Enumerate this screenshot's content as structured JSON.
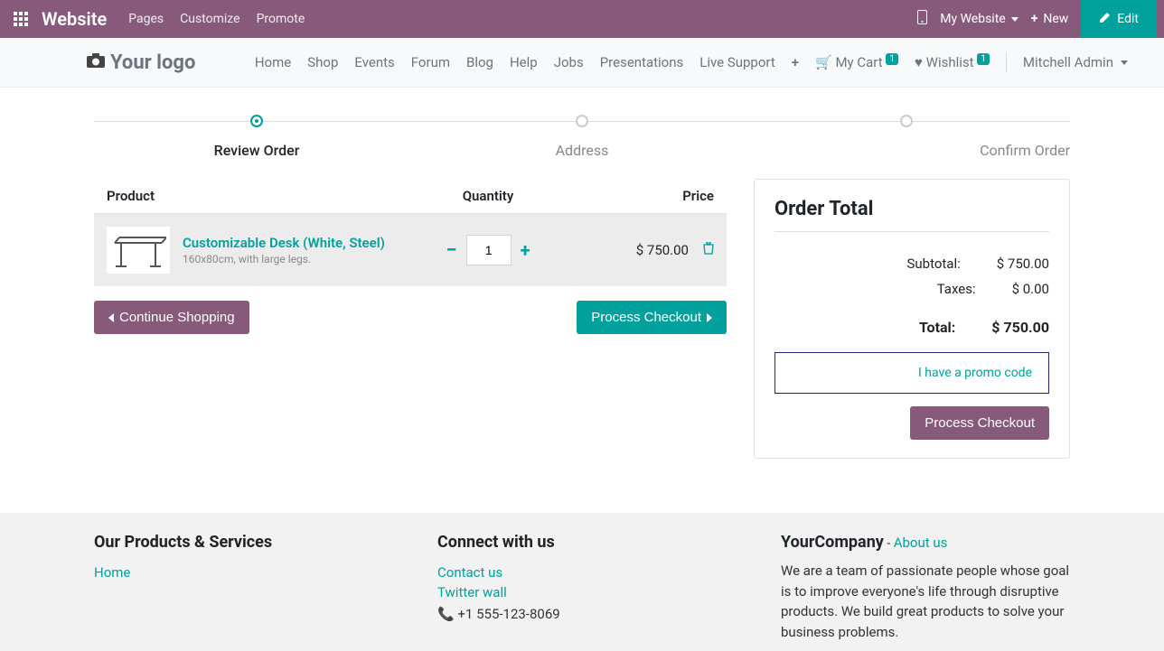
{
  "topbar": {
    "brand": "Website",
    "menu": [
      "Pages",
      "Customize",
      "Promote"
    ],
    "mywebsite": "My Website",
    "new": "New",
    "edit": "Edit"
  },
  "nav": {
    "logo": "Your logo",
    "items": [
      "Home",
      "Shop",
      "Events",
      "Forum",
      "Blog",
      "Help",
      "Jobs",
      "Presentations",
      "Live Support"
    ],
    "cart_label": "My Cart",
    "cart_count": "1",
    "wishlist_label": "Wishlist",
    "wishlist_count": "1",
    "user": "Mitchell Admin"
  },
  "wizard": {
    "steps": [
      "Review Order",
      "Address",
      "Confirm Order"
    ],
    "active": 0
  },
  "cart": {
    "headers": {
      "product": "Product",
      "quantity": "Quantity",
      "price": "Price"
    },
    "item": {
      "name": "Customizable Desk (White, Steel)",
      "desc": "160x80cm, with large legs.",
      "qty": "1",
      "price": "$ 750.00"
    },
    "continue": "Continue Shopping",
    "process": "Process Checkout"
  },
  "order": {
    "title": "Order Total",
    "subtotal_label": "Subtotal:",
    "subtotal": "$ 750.00",
    "taxes_label": "Taxes:",
    "taxes": "$ 0.00",
    "total_label": "Total:",
    "total": "$ 750.00",
    "promo": "I have a promo code",
    "process": "Process Checkout"
  },
  "footer": {
    "col1": {
      "title": "Our Products & Services",
      "links": [
        "Home"
      ]
    },
    "col2": {
      "title": "Connect with us",
      "links": [
        "Contact us",
        "Twitter wall"
      ],
      "phone": "+1 555-123-8069"
    },
    "col3": {
      "company": "YourCompany",
      "about_sep": " - ",
      "about": "About us",
      "text": "We are a team of passionate people whose goal is to improve everyone's life through disruptive products. We build great products to solve your business problems."
    }
  }
}
